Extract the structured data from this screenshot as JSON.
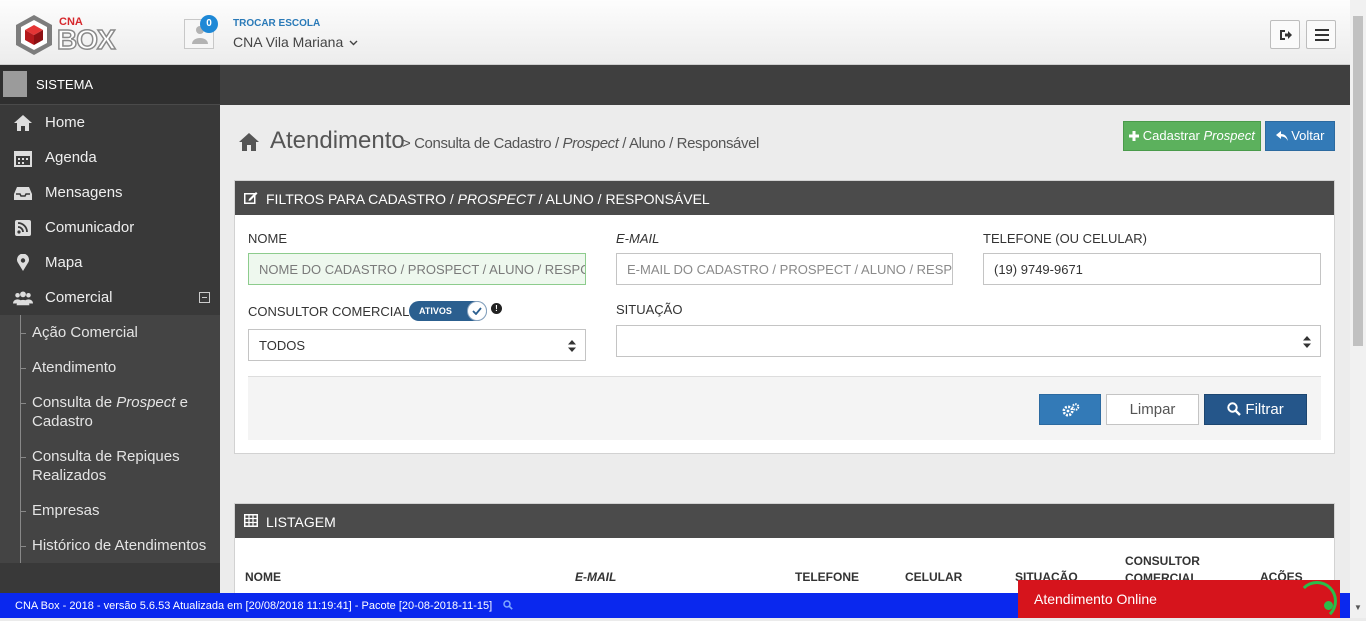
{
  "header": {
    "logo_top": "CNA",
    "logo_main": "BOX",
    "notification_count": "0",
    "switch_school_label": "TROCAR ESCOLA",
    "school_name": "CNA Vila Mariana"
  },
  "sidebar": {
    "user_label": "SISTEMA",
    "items": [
      {
        "label": "Home",
        "icon": "home-icon"
      },
      {
        "label": "Agenda",
        "icon": "calendar-icon"
      },
      {
        "label": "Mensagens",
        "icon": "inbox-icon"
      },
      {
        "label": "Comunicador",
        "icon": "rss-icon"
      },
      {
        "label": "Mapa",
        "icon": "map-marker-icon"
      },
      {
        "label": "Comercial",
        "icon": "users-icon"
      }
    ],
    "submenu": [
      {
        "label": "Ação Comercial"
      },
      {
        "label": "Atendimento"
      },
      {
        "label_pre": "Consulta de ",
        "label_em": "Prospect",
        "label_post": " e Cadastro"
      },
      {
        "label": "Consulta de Repiques Realizados"
      },
      {
        "label": "Empresas"
      },
      {
        "label": "Histórico de Atendimentos"
      }
    ]
  },
  "page": {
    "title": "Atendimento",
    "crumb_pre": "> Consulta de Cadastro / ",
    "crumb_em": "Prospect",
    "crumb_post": " / Aluno / Responsável",
    "btn_cadastrar_pre": "Cadastrar ",
    "btn_cadastrar_em": "Prospect",
    "btn_voltar": "Voltar"
  },
  "filters": {
    "title_pre": "FILTROS PARA CADASTRO / ",
    "title_em": "PROSPECT",
    "title_post": " / ALUNO / RESPONSÁVEL",
    "nome_label": "NOME",
    "nome_placeholder": "NOME DO CADASTRO / PROSPECT / ALUNO / RESPO",
    "email_label": "E-MAIL",
    "email_placeholder": "E-MAIL DO CADASTRO / PROSPECT / ALUNO / RESPC",
    "telefone_label": "TELEFONE (OU CELULAR)",
    "telefone_value": "(19) 9749-9671",
    "consultor_label": "CONSULTOR COMERCIAL",
    "ativos_toggle": "ATIVOS",
    "consultor_value": "TODOS",
    "situacao_label": "SITUAÇÃO",
    "situacao_value": "",
    "btn_limpar": "Limpar",
    "btn_filtrar": "Filtrar"
  },
  "listing": {
    "title": "LISTAGEM",
    "columns": [
      "NOME",
      "E-MAIL",
      "TELEFONE",
      "CELULAR",
      "SITUAÇÃO",
      "CONSULTOR COMERCIAL",
      "AÇÕES"
    ]
  },
  "statusbar": {
    "text": "CNA Box - 2018 - versão 5.6.53 Atualizada em [20/08/2018 11:19:41] - Pacote [20-08-2018-11-15]"
  },
  "chat": {
    "label": "Atendimento Online"
  },
  "colors": {
    "sidebar_bg": "#393939",
    "green_button": "#5cb15d",
    "blue_button": "#337ab7",
    "status_bar": "#0a28ee",
    "chat_red": "#d6141c"
  }
}
